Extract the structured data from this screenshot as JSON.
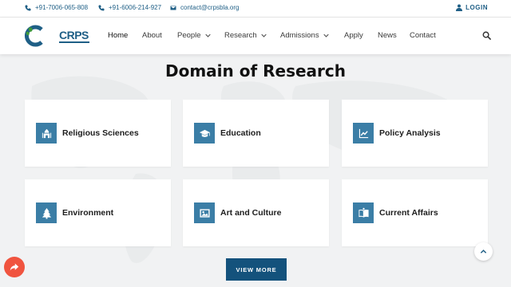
{
  "topbar": {
    "phone1": "+91-7006-065-808",
    "phone2": "+91-6006-214-927",
    "email": "contact@crpsbla.org",
    "login_label": "LOGIN"
  },
  "header": {
    "logo_text": "CRPS",
    "nav": [
      {
        "label": "Home",
        "active": true,
        "dropdown": false
      },
      {
        "label": "About",
        "active": false,
        "dropdown": false
      },
      {
        "label": "People",
        "active": false,
        "dropdown": true
      },
      {
        "label": "Research",
        "active": false,
        "dropdown": true
      },
      {
        "label": "Admissions",
        "active": false,
        "dropdown": true
      },
      {
        "label": "Apply",
        "active": false,
        "dropdown": false
      },
      {
        "label": "News",
        "active": false,
        "dropdown": false
      },
      {
        "label": "Contact",
        "active": false,
        "dropdown": false
      }
    ]
  },
  "main": {
    "title": "Domain of Research",
    "domains": [
      {
        "label": "Religious Sciences",
        "icon": "mosque-icon"
      },
      {
        "label": "Education",
        "icon": "graduation-cap-icon"
      },
      {
        "label": "Policy Analysis",
        "icon": "chart-line-icon"
      },
      {
        "label": "Environment",
        "icon": "tree-icon"
      },
      {
        "label": "Art and Culture",
        "icon": "image-icon"
      },
      {
        "label": "Current Affairs",
        "icon": "newspaper-icon"
      }
    ],
    "view_more_label": "VIEW MORE"
  },
  "colors": {
    "brand_blue": "#1f5f86",
    "icon_bg": "#3b7ea6",
    "button_bg": "#14527c",
    "share_button": "#f0543f",
    "logo_green": "#3f9a3a"
  }
}
